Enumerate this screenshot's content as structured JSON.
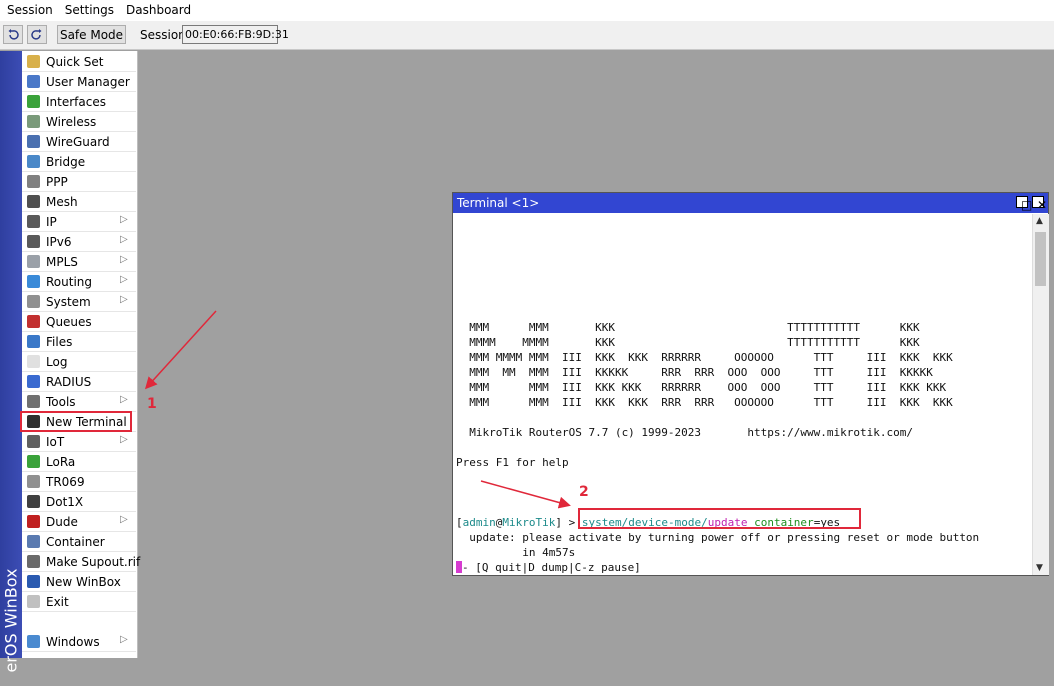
{
  "menubar": {
    "items": [
      "Session",
      "Settings",
      "Dashboard"
    ]
  },
  "toolbar": {
    "undo_icon": "undo-icon",
    "redo_icon": "redo-icon",
    "safe_mode_label": "Safe Mode",
    "session_label": "Session:",
    "session_value": "00:E0:66:FB:9D:31"
  },
  "brand": {
    "vertical_text": "erOS WinBox"
  },
  "sidebar": {
    "items": [
      {
        "label": "Quick Set",
        "icon": "wand-icon",
        "color": "#d8b04a",
        "submenu": false
      },
      {
        "label": "User Manager",
        "icon": "users-icon",
        "color": "#4a78c8",
        "submenu": false
      },
      {
        "label": "Interfaces",
        "icon": "interfaces-icon",
        "color": "#3aa23a",
        "submenu": false
      },
      {
        "label": "Wireless",
        "icon": "wireless-icon",
        "color": "#7a9a7a",
        "submenu": false
      },
      {
        "label": "WireGuard",
        "icon": "wireguard-icon",
        "color": "#4a70b0",
        "submenu": false
      },
      {
        "label": "Bridge",
        "icon": "bridge-icon",
        "color": "#4a88c8",
        "submenu": false
      },
      {
        "label": "PPP",
        "icon": "ppp-icon",
        "color": "#808080",
        "submenu": false
      },
      {
        "label": "Mesh",
        "icon": "mesh-icon",
        "color": "#505050",
        "submenu": false
      },
      {
        "label": "IP",
        "icon": "ip-icon",
        "color": "#5a5a5a",
        "submenu": true
      },
      {
        "label": "IPv6",
        "icon": "ipv6-icon",
        "color": "#5a5a5a",
        "submenu": true
      },
      {
        "label": "MPLS",
        "icon": "mpls-icon",
        "color": "#9aa0a8",
        "submenu": true
      },
      {
        "label": "Routing",
        "icon": "routing-icon",
        "color": "#3a8ad8",
        "submenu": true
      },
      {
        "label": "System",
        "icon": "system-gear-icon",
        "color": "#909090",
        "submenu": true
      },
      {
        "label": "Queues",
        "icon": "queues-icon",
        "color": "#c23030",
        "submenu": false
      },
      {
        "label": "Files",
        "icon": "files-icon",
        "color": "#3a78c8",
        "submenu": false
      },
      {
        "label": "Log",
        "icon": "log-icon",
        "color": "#e0e0e0",
        "submenu": false
      },
      {
        "label": "RADIUS",
        "icon": "radius-icon",
        "color": "#3a6ad0",
        "submenu": false
      },
      {
        "label": "Tools",
        "icon": "tools-icon",
        "color": "#707070",
        "submenu": true
      },
      {
        "label": "New Terminal",
        "icon": "terminal-icon",
        "color": "#303030",
        "submenu": false
      },
      {
        "label": "IoT",
        "icon": "iot-icon",
        "color": "#606060",
        "submenu": true
      },
      {
        "label": "LoRa",
        "icon": "lora-icon",
        "color": "#3aa23a",
        "submenu": false
      },
      {
        "label": "TR069",
        "icon": "tr069-icon",
        "color": "#909090",
        "submenu": false
      },
      {
        "label": "Dot1X",
        "icon": "dot1x-icon",
        "color": "#404040",
        "submenu": false
      },
      {
        "label": "Dude",
        "icon": "dude-icon",
        "color": "#c02020",
        "submenu": true
      },
      {
        "label": "Container",
        "icon": "container-icon",
        "color": "#5a7ab0",
        "submenu": false
      },
      {
        "label": "Make Supout.rif",
        "icon": "supout-icon",
        "color": "#6a6a6a",
        "submenu": false
      },
      {
        "label": "New WinBox",
        "icon": "winbox-icon",
        "color": "#2a5ab0",
        "submenu": false
      },
      {
        "label": "Exit",
        "icon": "exit-icon",
        "color": "#c0c0c0",
        "submenu": false
      }
    ],
    "bottom_item": {
      "label": "Windows",
      "icon": "windows-icon",
      "color": "#4a8ad0",
      "submenu": true
    }
  },
  "terminal": {
    "title": "Terminal <1>",
    "logo_lines": [
      "  MMM      MMM       KKK                          TTTTTTTTTTT      KKK",
      "  MMMM    MMMM       KKK                          TTTTTTTTTTT      KKK",
      "  MMM MMMM MMM  III  KKK  KKK  RRRRRR     OOOOOO      TTT     III  KKK  KKK",
      "  MMM  MM  MMM  III  KKKKK     RRR  RRR  OOO  OOO     TTT     III  KKKKK",
      "  MMM      MMM  III  KKK KKK   RRRRRR    OOO  OOO     TTT     III  KKK KKK",
      "  MMM      MMM  III  KKK  KKK  RRR  RRR   OOOOOO      TTT     III  KKK  KKK"
    ],
    "version_line": "  MikroTik RouterOS 7.7 (c) 1999-2023       https://www.mikrotik.com/",
    "help_line": "Press F1 for help",
    "prompt": {
      "open": "[",
      "user": "admin",
      "at": "@",
      "host": "MikroTik",
      "close": "] > ",
      "cmd_path": "system/device-mode/",
      "cmd_action": "update",
      "cmd_param": " container",
      "cmd_eq": "=",
      "cmd_value": "yes"
    },
    "output_line1": "  update: please activate by turning power off or pressing reset or mode button",
    "output_line2": "          in 4m57s",
    "status_line": "- [Q quit|D dump|C-z pause]"
  },
  "annotations": {
    "step1": "1",
    "step2": "2"
  },
  "colors": {
    "accent_red": "#e0283a",
    "title_blue": "#3246d2"
  }
}
